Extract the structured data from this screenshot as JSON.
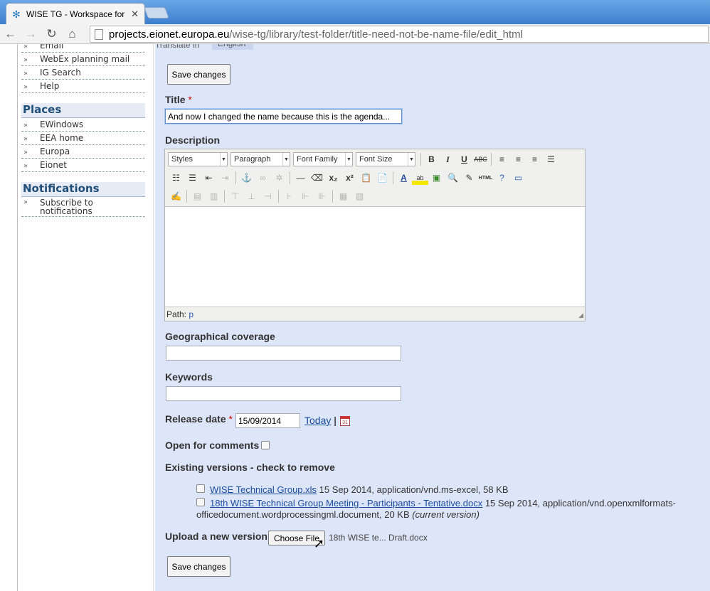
{
  "browser": {
    "tab_title": "WISE TG - Workspace for",
    "url_host": "projects.eionet.europa.eu",
    "url_path": "/wise-tg/library/test-folder/title-need-not-be-name-file/edit_html"
  },
  "sidebar": {
    "top_items": [
      "Email",
      "WebEx planning mail",
      "IG Search",
      "Help"
    ],
    "places_heading": "Places",
    "places": [
      "EWindows",
      "EEA home",
      "Europa",
      "Eionet"
    ],
    "notifications_heading": "Notifications",
    "notifications": [
      "Subscribe to notifications"
    ]
  },
  "form": {
    "translate_label": "Translate in",
    "translate_lang": "English",
    "save_label": "Save changes",
    "title_label": "Title",
    "required_mark": "*",
    "title_value": "And now I changed the name because this is the agenda...",
    "description_label": "Description",
    "editor": {
      "styles": "Styles",
      "paragraph": "Paragraph",
      "font_family": "Font Family",
      "font_size": "Font Size",
      "path_label": "Path:",
      "path_value": "p"
    },
    "geo_label": "Geographical coverage",
    "keywords_label": "Keywords",
    "release_label": "Release date",
    "release_value": "15/09/2014",
    "today_label": "Today",
    "pipe": "|",
    "comments_label": "Open for comments",
    "versions_label": "Existing versions - check to remove",
    "versions": [
      {
        "name": "WISE Technical Group.xls",
        "info": " 15 Sep 2014, application/vnd.ms-excel, 58 KB"
      },
      {
        "name": "18th WISE Technical Group Meeting - Participants - Tentative.docx",
        "info": " 15 Sep 2014, application/vnd.openxmlformats-",
        "info2": "officedocument.wordprocessingml.document, 20 KB ",
        "current": "(current version)"
      }
    ],
    "upload_label": "Upload a new version",
    "choose_file": "Choose File",
    "chosen_file": "18th WISE te... Draft.docx"
  },
  "colors": {
    "content_bg": "#dde5f8",
    "link": "#1a4c9e",
    "heading": "#1f4e79"
  }
}
